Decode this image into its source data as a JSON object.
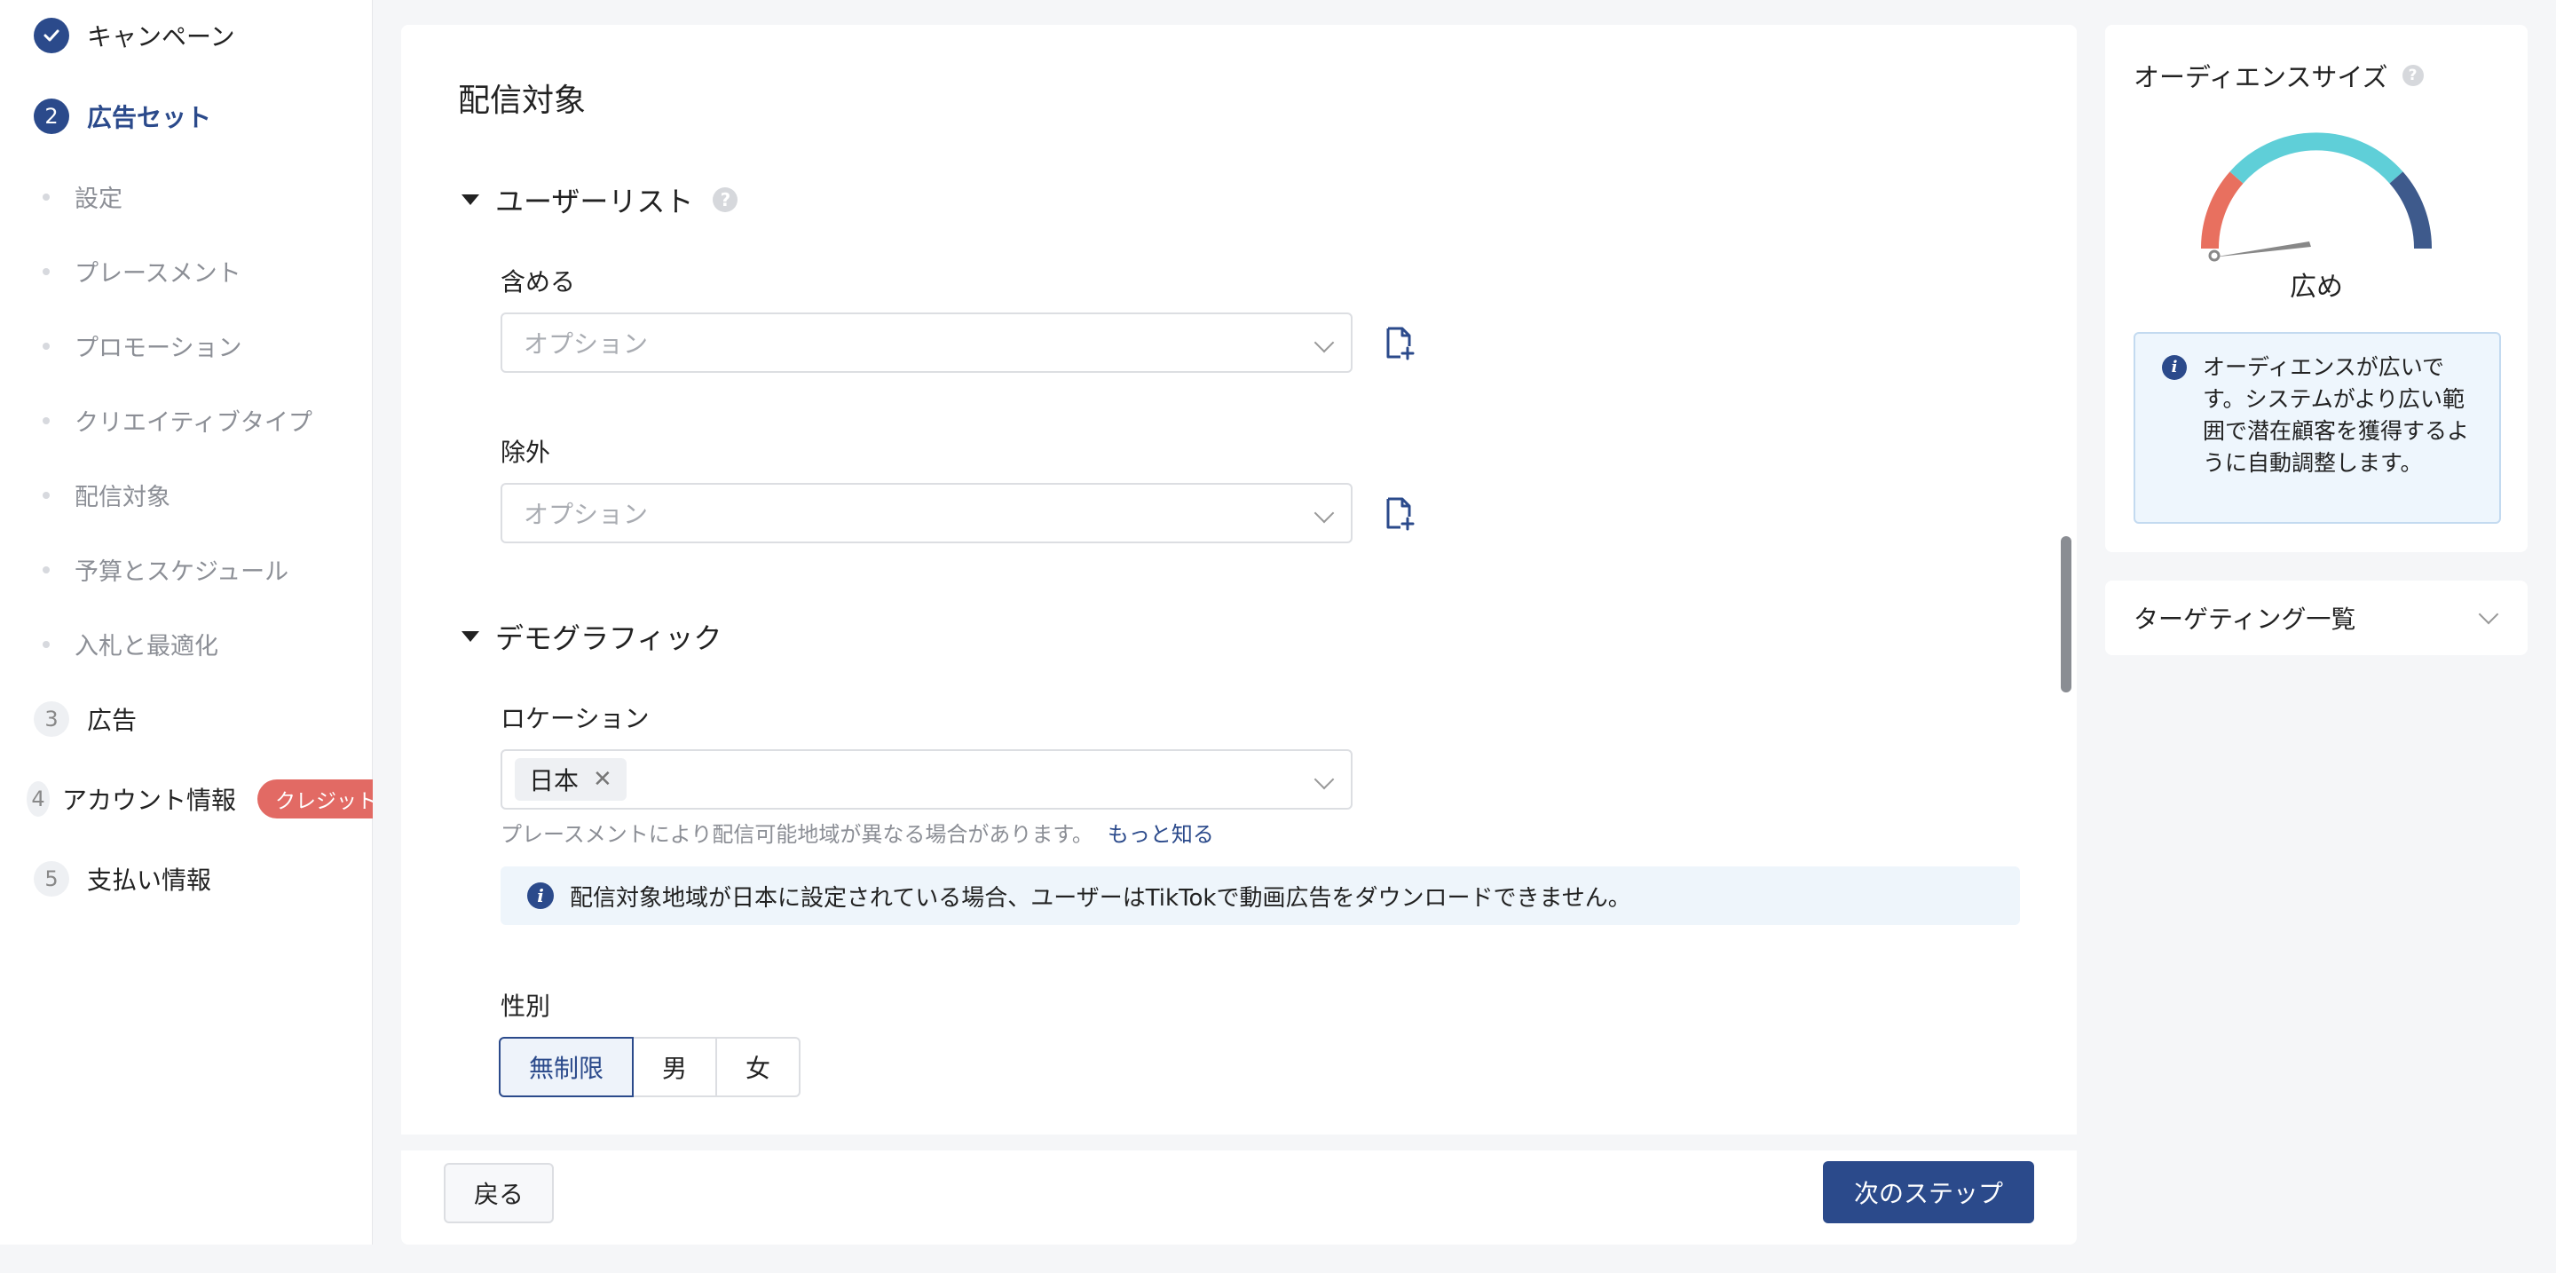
{
  "sidebar": {
    "steps": [
      {
        "label": "キャンペーン",
        "number": "✓",
        "state": "done"
      },
      {
        "label": "広告セット",
        "number": "2",
        "state": "active"
      },
      {
        "label": "広告",
        "number": "3",
        "state": "todo"
      },
      {
        "label": "アカウント情報",
        "number": "4",
        "state": "todo"
      },
      {
        "label": "支払い情報",
        "number": "5",
        "state": "todo"
      }
    ],
    "sub_items": [
      "設定",
      "プレースメント",
      "プロモーション",
      "クリエイティブタイプ",
      "配信対象",
      "予算とスケジュール",
      "入札と最適化"
    ],
    "credit_badge": "クレジット"
  },
  "main": {
    "section_title": "配信対象",
    "user_list": {
      "header": "ユーザーリスト",
      "include_label": "含める",
      "include_placeholder": "オプション",
      "exclude_label": "除外",
      "exclude_placeholder": "オプション"
    },
    "demographic": {
      "header": "デモグラフィック",
      "location_label": "ロケーション",
      "location_tag": "日本",
      "location_hint": "プレースメントにより配信可能地域が異なる場合があります。",
      "learn_more": "もっと知る",
      "notice": "配信対象地域が日本に設定されている場合、ユーザーはTikTokで動画広告をダウンロードできません。",
      "gender_label": "性別",
      "gender_options": [
        "無制限",
        "男",
        "女"
      ],
      "gender_selected": "無制限"
    },
    "back_button": "戻る",
    "next_button": "次のステップ"
  },
  "audience": {
    "title": "オーディエンスサイズ",
    "gauge_label": "広め",
    "info_text": "オーディエンスが広いです。システムがより広い範囲で潜在顧客を獲得するように自動調整します。",
    "targeting_summary": "ターゲティング一覧"
  },
  "colors": {
    "accent": "#2b4a8b",
    "gauge_low": "#e8705f",
    "gauge_mid": "#5fcfd8",
    "gauge_high": "#3e5a8c"
  }
}
